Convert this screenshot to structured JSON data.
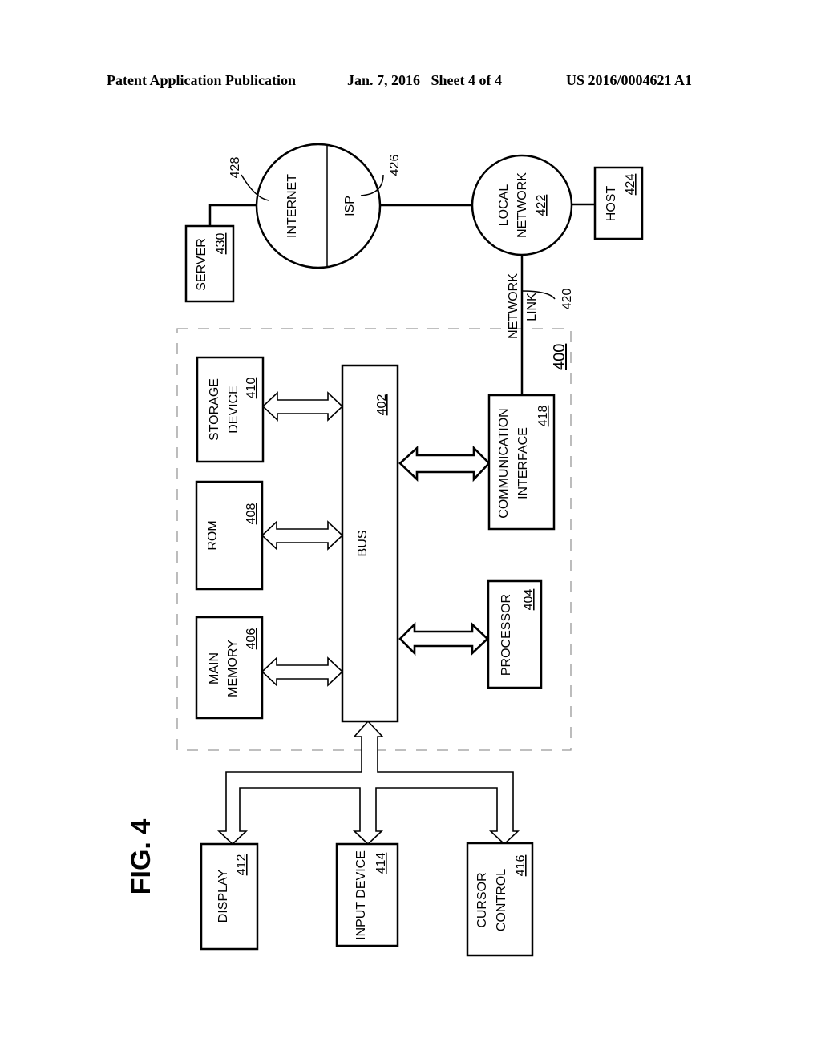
{
  "header": {
    "left": "Patent Application Publication",
    "middle": "Jan. 7, 2016   Sheet 4 of 4",
    "right": "US 2016/0004621 A1"
  },
  "figure": {
    "label": "FIG. 4",
    "system_ref": "400",
    "bus": {
      "label": "BUS",
      "ref": "402"
    },
    "processor": {
      "label": "PROCESSOR",
      "ref": "404"
    },
    "main_memory": {
      "line1": "MAIN",
      "line2": "MEMORY",
      "ref": "406"
    },
    "rom": {
      "label": "ROM",
      "ref": "408"
    },
    "storage_device": {
      "line1": "STORAGE",
      "line2": "DEVICE",
      "ref": "410"
    },
    "display": {
      "label": "DISPLAY",
      "ref": "412"
    },
    "input_device": {
      "label": "INPUT DEVICE",
      "ref": "414"
    },
    "cursor_control": {
      "line1": "CURSOR",
      "line2": "CONTROL",
      "ref": "416"
    },
    "communication_interface": {
      "line1": "COMMUNICATION",
      "line2": "INTERFACE",
      "ref": "418"
    },
    "network_link": {
      "line1": "NETWORK",
      "line2": "LINK",
      "ref": "420"
    },
    "local_network": {
      "line1": "LOCAL",
      "line2": "NETWORK",
      "ref": "422"
    },
    "host": {
      "label": "HOST",
      "ref": "424"
    },
    "isp": {
      "label": "ISP",
      "ref": "426"
    },
    "internet": {
      "label": "INTERNET",
      "ref": "428"
    },
    "server": {
      "label": "SERVER",
      "ref": "430"
    }
  }
}
